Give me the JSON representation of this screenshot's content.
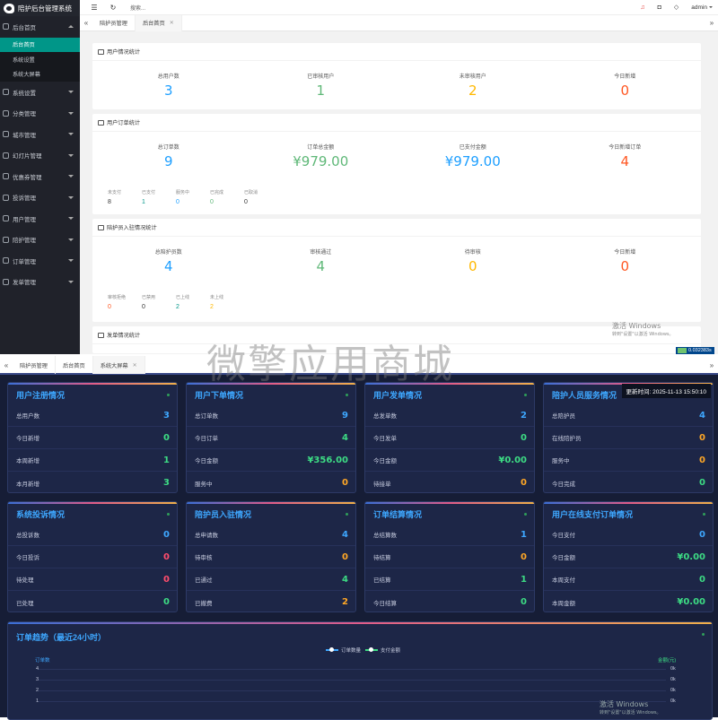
{
  "top": {
    "brand": "陪护后台管理系统",
    "sidebar": [
      {
        "label": "后台首页",
        "open": true,
        "children": [
          {
            "label": "后台首页",
            "active": true
          },
          {
            "label": "系统设置",
            "active": false
          },
          {
            "label": "系统大屏幕",
            "active": false
          }
        ]
      },
      {
        "label": "系统设置"
      },
      {
        "label": "分类管理"
      },
      {
        "label": "城市管理"
      },
      {
        "label": "幻灯片管理"
      },
      {
        "label": "优惠券管理"
      },
      {
        "label": "投诉管理"
      },
      {
        "label": "用户管理"
      },
      {
        "label": "陪护管理"
      },
      {
        "label": "订单管理"
      },
      {
        "label": "发单管理"
      }
    ],
    "topbar": {
      "search_placeholder": "搜索...",
      "user": "admin"
    },
    "tabs": [
      {
        "label": "陪护员管理",
        "active": false
      },
      {
        "label": "后台首页",
        "active": true
      }
    ],
    "cards": {
      "users": {
        "title": "用户情况统计",
        "stats": [
          {
            "label": "总用户数",
            "value": "3",
            "color": "blue"
          },
          {
            "label": "已审核用户",
            "value": "1",
            "color": "green"
          },
          {
            "label": "未审核用户",
            "value": "2",
            "color": "orange"
          },
          {
            "label": "今日新增",
            "value": "0",
            "color": "red2"
          }
        ]
      },
      "orders": {
        "title": "用户订单统计",
        "stats": [
          {
            "label": "总订单数",
            "value": "9",
            "color": "blue"
          },
          {
            "label": "订单总金额",
            "value": "¥979.00",
            "color": "green"
          },
          {
            "label": "已支付金额",
            "value": "¥979.00",
            "color": "blue"
          },
          {
            "label": "今日新增订单",
            "value": "4",
            "color": "red2"
          }
        ],
        "mini": [
          {
            "label": "未支付",
            "value": "8",
            "color": "dark"
          },
          {
            "label": "已支付",
            "value": "1",
            "color": "teal"
          },
          {
            "label": "服务中",
            "value": "0",
            "color": "blue"
          },
          {
            "label": "已完成",
            "value": "0",
            "color": "green"
          },
          {
            "label": "已取消",
            "value": "0",
            "color": "dark"
          }
        ]
      },
      "nurses": {
        "title": "陪护员入驻情况统计",
        "stats": [
          {
            "label": "总陪护员数",
            "value": "4",
            "color": "blue"
          },
          {
            "label": "审核通过",
            "value": "4",
            "color": "green"
          },
          {
            "label": "待审核",
            "value": "0",
            "color": "orange"
          },
          {
            "label": "今日新增",
            "value": "0",
            "color": "red2"
          }
        ],
        "mini": [
          {
            "label": "审核拒绝",
            "value": "0",
            "color": "red2"
          },
          {
            "label": "已禁用",
            "value": "0",
            "color": "dark"
          },
          {
            "label": "已上线",
            "value": "2",
            "color": "teal"
          },
          {
            "label": "未上线",
            "value": "2",
            "color": "orange"
          }
        ]
      },
      "dispatch": {
        "title": "发单情况统计"
      }
    },
    "win_watermark": {
      "line1": "激活 Windows",
      "line2": "转到\"设置\"以激活 Windows。"
    },
    "speed": "0.032383s"
  },
  "watermark": "微擎应用商城",
  "bottom": {
    "tabs": [
      {
        "label": "陪护员管理",
        "active": false
      },
      {
        "label": "后台首页",
        "active": false
      },
      {
        "label": "系统大屏幕",
        "active": true
      }
    ],
    "update_time": "更新时间: 2025-11-13 15:50:10",
    "cards": [
      {
        "title": "用户注册情况",
        "rows": [
          [
            "总用户数",
            "3",
            "blue"
          ],
          [
            "今日新增",
            "0",
            "green"
          ],
          [
            "本周新增",
            "1",
            "green"
          ],
          [
            "本月新增",
            "3",
            "green"
          ]
        ]
      },
      {
        "title": "用户下单情况",
        "rows": [
          [
            "总订单数",
            "9",
            "blue"
          ],
          [
            "今日订单",
            "4",
            "green"
          ],
          [
            "今日金额",
            "¥356.00",
            "green"
          ],
          [
            "服务中",
            "0",
            "orange"
          ]
        ]
      },
      {
        "title": "用户发单情况",
        "rows": [
          [
            "总发单数",
            "2",
            "blue"
          ],
          [
            "今日发单",
            "0",
            "green"
          ],
          [
            "今日金额",
            "¥0.00",
            "green"
          ],
          [
            "待接单",
            "0",
            "orange"
          ]
        ]
      },
      {
        "title": "陪护人员服务情况",
        "rows": [
          [
            "总陪护员",
            "4",
            "blue"
          ],
          [
            "在线陪护员",
            "0",
            "orange"
          ],
          [
            "服务中",
            "0",
            "orange"
          ],
          [
            "今日完成",
            "0",
            "green"
          ]
        ]
      },
      {
        "title": "系统投诉情况",
        "rows": [
          [
            "总投诉数",
            "0",
            "blue"
          ],
          [
            "今日投诉",
            "0",
            "red"
          ],
          [
            "待处理",
            "0",
            "red"
          ],
          [
            "已处理",
            "0",
            "green"
          ]
        ]
      },
      {
        "title": "陪护员入驻情况",
        "rows": [
          [
            "总申请数",
            "4",
            "blue"
          ],
          [
            "待审核",
            "0",
            "orange"
          ],
          [
            "已通过",
            "4",
            "green"
          ],
          [
            "已撤费",
            "2",
            "orange"
          ]
        ]
      },
      {
        "title": "订单结算情况",
        "rows": [
          [
            "总结算数",
            "1",
            "blue"
          ],
          [
            "待结算",
            "0",
            "orange"
          ],
          [
            "已结算",
            "1",
            "green"
          ],
          [
            "今日结算",
            "0",
            "green"
          ]
        ]
      },
      {
        "title": "用户在线支付订单情况",
        "rows": [
          [
            "今日支付",
            "0",
            "blue"
          ],
          [
            "今日金额",
            "¥0.00",
            "green"
          ],
          [
            "本周支付",
            "0",
            "green"
          ],
          [
            "本周金额",
            "¥0.00",
            "green"
          ]
        ]
      }
    ],
    "chart_data": {
      "type": "line",
      "title": "订单趋势（最近24小时）",
      "series": [
        {
          "name": "订单数量",
          "color": "#3ea7ff"
        },
        {
          "name": "支付金额",
          "color": "#3ddc84"
        }
      ],
      "ylabel": "订单数",
      "ylabel_right": "金额(元)",
      "y_ticks": [
        "4",
        "3",
        "2",
        "1"
      ],
      "y_ticks_right": [
        "0k",
        "0k",
        "0k",
        "0k"
      ]
    },
    "win_watermark": {
      "line1": "激活 Windows",
      "line2": "转到\"设置\"以激活 Windows。"
    }
  }
}
